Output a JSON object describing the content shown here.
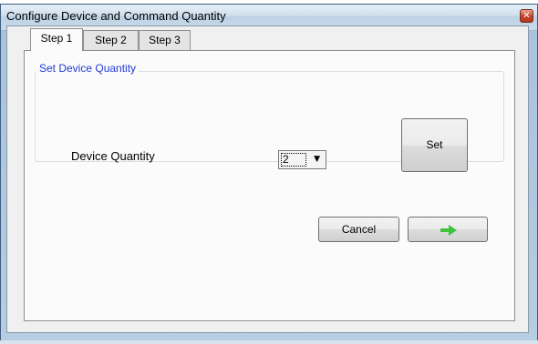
{
  "window": {
    "title": "Configure Device and Command Quantity",
    "close_icon": "close-icon"
  },
  "tabs": [
    {
      "label": "Step 1",
      "active": true
    },
    {
      "label": "Step 2",
      "active": false
    },
    {
      "label": "Step 3",
      "active": false
    }
  ],
  "group": {
    "title": "Set Device Quantity",
    "device_quantity_label": "Device Quantity",
    "device_quantity_value": "2",
    "set_label": "Set"
  },
  "footer": {
    "cancel_label": "Cancel",
    "next_icon": "right-arrow-icon"
  },
  "colors": {
    "group_title": "#1f3bd6",
    "arrow": "#3cc43a",
    "titlebar": "#cfdeec"
  }
}
